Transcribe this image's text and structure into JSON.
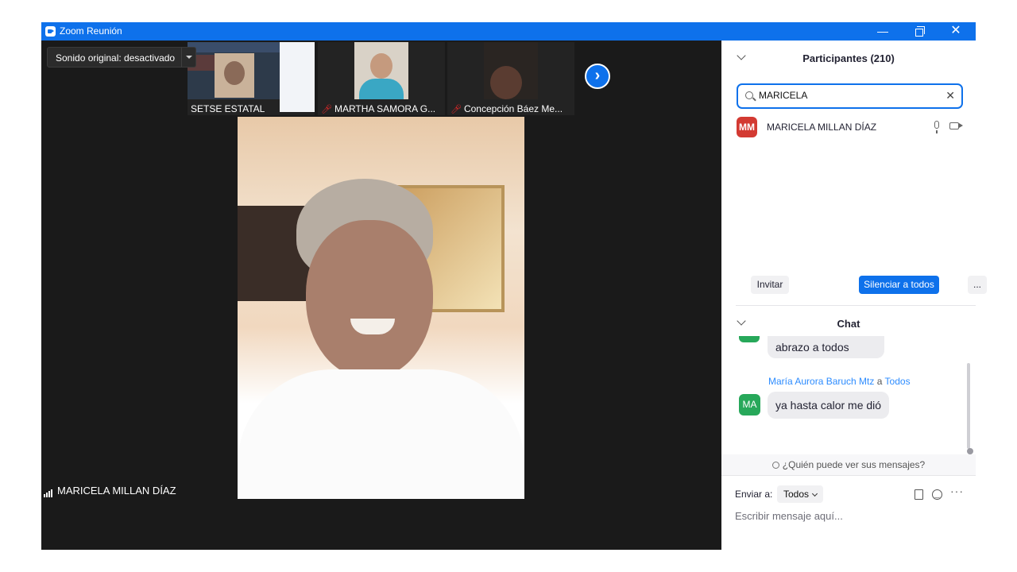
{
  "window": {
    "title": "Zoom Reunión",
    "min_symbol": "—",
    "close_symbol": "✕"
  },
  "thumbnails": [
    {
      "name": "SETSE ESTATAL",
      "muted": false
    },
    {
      "name": "MARTHA SAMORA G...",
      "muted": true
    },
    {
      "name": "Concepción Báez Me...",
      "muted": true
    }
  ],
  "strip_next_symbol": "›",
  "main_video": {
    "audio_option": "Sonido original: desactivado",
    "speaker_name": "MARICELA MILLAN DÍAZ"
  },
  "participants": {
    "title": "Participantes (210)",
    "search_value": "MARICELA",
    "clear_symbol": "✕",
    "list": [
      {
        "initials": "MM",
        "name": "MARICELA MILLAN DÍAZ"
      }
    ],
    "buttons": {
      "invite": "Invitar",
      "mute_all": "Silenciar a todos",
      "more": "..."
    }
  },
  "chat": {
    "title": "Chat",
    "messages": [
      {
        "text": "abrazo a todos"
      },
      {
        "sender": "María Aurora Baruch Mtz",
        "to_word": "a",
        "recipient": "Todos",
        "initials": "MA",
        "text": "ya hasta calor me dió"
      }
    ],
    "who_can_see": "¿Quién puede ver sus mensajes?",
    "send_to_label": "Enviar a:",
    "send_to_value": "Todos",
    "more_symbol": "···",
    "compose_placeholder": "Escribir mensaje aquí..."
  },
  "colors": {
    "brand_blue": "#0e71eb",
    "avatar_red": "#d33a32",
    "avatar_green": "#27a85a",
    "muted_red": "#e02828"
  }
}
